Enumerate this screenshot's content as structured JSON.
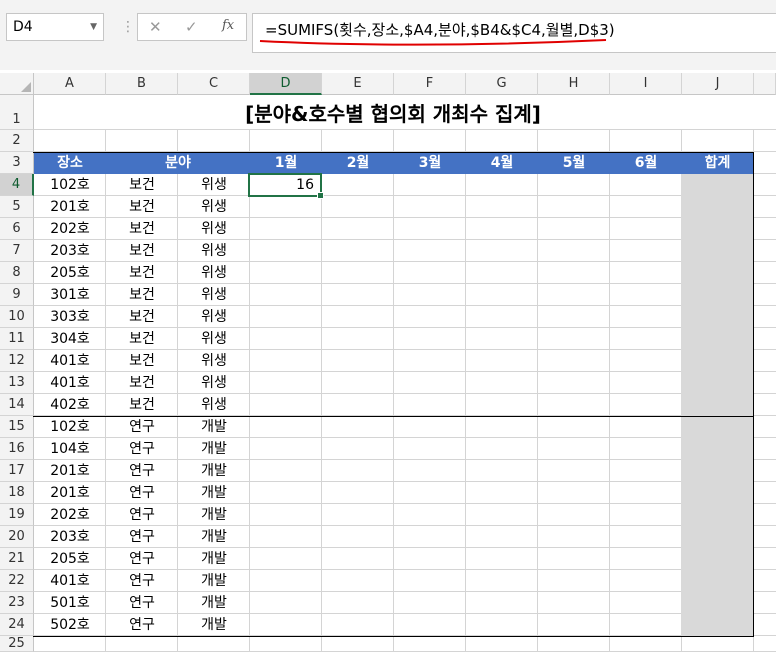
{
  "formula_bar": {
    "name_box": "D4",
    "cancel_icon": "✕",
    "enter_icon": "✓",
    "fx_label": "fx",
    "formula": "=SUMIFS(횟수,장소,$A4,분야,$B4&$C4,월별,D$3)"
  },
  "columns": [
    "A",
    "B",
    "C",
    "D",
    "E",
    "F",
    "G",
    "H",
    "I",
    "J"
  ],
  "rows": [
    "1",
    "2",
    "3",
    "4",
    "5",
    "6",
    "7",
    "8",
    "9",
    "10",
    "11",
    "12",
    "13",
    "14",
    "15",
    "16",
    "17",
    "18",
    "19",
    "20",
    "21",
    "22",
    "23",
    "24",
    "25"
  ],
  "sheet": {
    "title": "[분야&호수별 협의회 개최수 집계]",
    "headers": {
      "place": "장소",
      "field": "분야",
      "months": [
        "1월",
        "2월",
        "3월",
        "4월",
        "5월",
        "6월"
      ],
      "total": "합계"
    },
    "data_rows": [
      {
        "place": "102호",
        "b": "보건",
        "c": "위생",
        "d": "16"
      },
      {
        "place": "201호",
        "b": "보건",
        "c": "위생",
        "d": ""
      },
      {
        "place": "202호",
        "b": "보건",
        "c": "위생",
        "d": ""
      },
      {
        "place": "203호",
        "b": "보건",
        "c": "위생",
        "d": ""
      },
      {
        "place": "205호",
        "b": "보건",
        "c": "위생",
        "d": ""
      },
      {
        "place": "301호",
        "b": "보건",
        "c": "위생",
        "d": ""
      },
      {
        "place": "303호",
        "b": "보건",
        "c": "위생",
        "d": ""
      },
      {
        "place": "304호",
        "b": "보건",
        "c": "위생",
        "d": ""
      },
      {
        "place": "401호",
        "b": "보건",
        "c": "위생",
        "d": ""
      },
      {
        "place": "401호",
        "b": "보건",
        "c": "위생",
        "d": ""
      },
      {
        "place": "402호",
        "b": "보건",
        "c": "위생",
        "d": ""
      },
      {
        "place": "102호",
        "b": "연구",
        "c": "개발",
        "d": ""
      },
      {
        "place": "104호",
        "b": "연구",
        "c": "개발",
        "d": ""
      },
      {
        "place": "201호",
        "b": "연구",
        "c": "개발",
        "d": ""
      },
      {
        "place": "201호",
        "b": "연구",
        "c": "개발",
        "d": ""
      },
      {
        "place": "202호",
        "b": "연구",
        "c": "개발",
        "d": ""
      },
      {
        "place": "203호",
        "b": "연구",
        "c": "개발",
        "d": ""
      },
      {
        "place": "205호",
        "b": "연구",
        "c": "개발",
        "d": ""
      },
      {
        "place": "401호",
        "b": "연구",
        "c": "개발",
        "d": ""
      },
      {
        "place": "501호",
        "b": "연구",
        "c": "개발",
        "d": ""
      },
      {
        "place": "502호",
        "b": "연구",
        "c": "개발",
        "d": ""
      }
    ]
  },
  "colors": {
    "header_fill": "#4472c4",
    "total_fill": "#d9d9d9",
    "selection": "#217346",
    "annotation": "#e00000"
  }
}
